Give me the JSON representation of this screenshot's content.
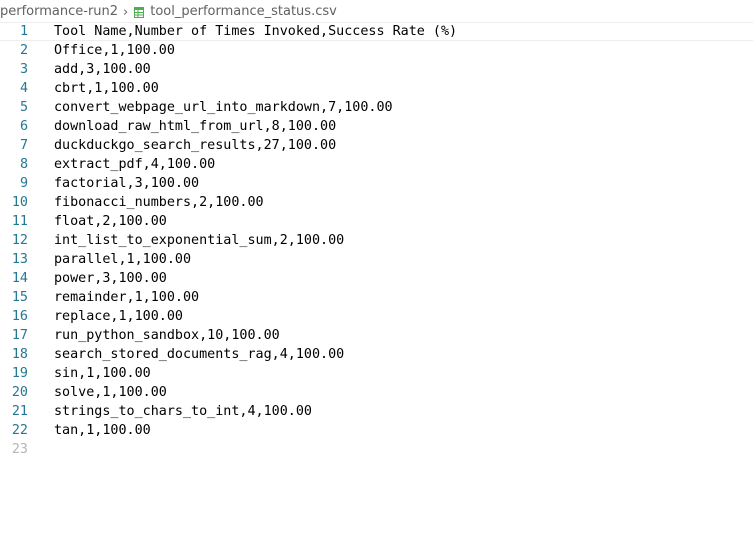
{
  "breadcrumb": {
    "folder": "performance-run2",
    "file": "tool_performance_status.csv",
    "separator": "›"
  },
  "icons": {
    "separator": "chevron-right-icon",
    "file": "csv-file-icon",
    "file_icon_color": "#4caf50"
  },
  "editor": {
    "lines": [
      {
        "number": "1",
        "text": "Tool Name,Number of Times Invoked,Success Rate (%)"
      },
      {
        "number": "2",
        "text": "Office,1,100.00"
      },
      {
        "number": "3",
        "text": "add,3,100.00"
      },
      {
        "number": "4",
        "text": "cbrt,1,100.00"
      },
      {
        "number": "5",
        "text": "convert_webpage_url_into_markdown,7,100.00"
      },
      {
        "number": "6",
        "text": "download_raw_html_from_url,8,100.00"
      },
      {
        "number": "7",
        "text": "duckduckgo_search_results,27,100.00"
      },
      {
        "number": "8",
        "text": "extract_pdf,4,100.00"
      },
      {
        "number": "9",
        "text": "factorial,3,100.00"
      },
      {
        "number": "10",
        "text": "fibonacci_numbers,2,100.00"
      },
      {
        "number": "11",
        "text": "float,2,100.00"
      },
      {
        "number": "12",
        "text": "int_list_to_exponential_sum,2,100.00"
      },
      {
        "number": "13",
        "text": "parallel,1,100.00"
      },
      {
        "number": "14",
        "text": "power,3,100.00"
      },
      {
        "number": "15",
        "text": "remainder,1,100.00"
      },
      {
        "number": "16",
        "text": "replace,1,100.00"
      },
      {
        "number": "17",
        "text": "run_python_sandbox,10,100.00"
      },
      {
        "number": "18",
        "text": "search_stored_documents_rag,4,100.00"
      },
      {
        "number": "19",
        "text": "sin,1,100.00"
      },
      {
        "number": "20",
        "text": "solve,1,100.00"
      },
      {
        "number": "21",
        "text": "strings_to_chars_to_int,4,100.00"
      },
      {
        "number": "22",
        "text": "tan,1,100.00"
      },
      {
        "number": "23",
        "text": ""
      }
    ]
  }
}
